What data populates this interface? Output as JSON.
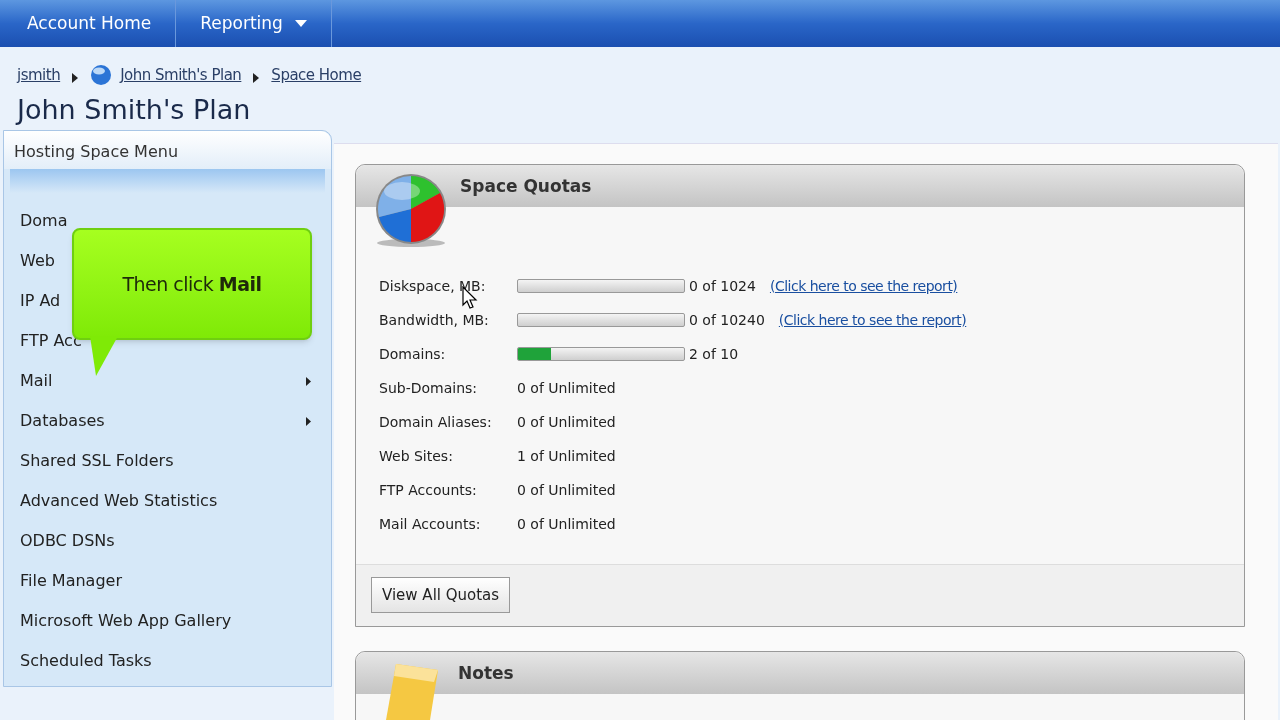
{
  "nav": [
    {
      "label": "Account Home",
      "dropdown": false
    },
    {
      "label": "Reporting",
      "dropdown": true
    }
  ],
  "breadcrumb": [
    {
      "label": "jsmith",
      "icon": false
    },
    {
      "label": "John Smith's Plan",
      "icon": true
    },
    {
      "label": "Space Home",
      "icon": false
    }
  ],
  "page_title": "John Smith's Plan",
  "sidebar": {
    "title": "Hosting Space Menu",
    "items": [
      {
        "label": "Doma",
        "submenu": false
      },
      {
        "label": "Web",
        "submenu": false
      },
      {
        "label": "IP Ad",
        "submenu": false
      },
      {
        "label": "FTP Acc",
        "submenu": false
      },
      {
        "label": "Mail",
        "submenu": true
      },
      {
        "label": "Databases",
        "submenu": true
      },
      {
        "label": "Shared SSL Folders",
        "submenu": false
      },
      {
        "label": "Advanced Web Statistics",
        "submenu": false
      },
      {
        "label": "ODBC DSNs",
        "submenu": false
      },
      {
        "label": "File Manager",
        "submenu": false
      },
      {
        "label": "Microsoft Web App Gallery",
        "submenu": false
      },
      {
        "label": "Scheduled Tasks",
        "submenu": false
      }
    ]
  },
  "callout": "Then click **Mail**",
  "quotas": {
    "title": "Space Quotas",
    "rows": [
      {
        "kind": "bar",
        "label": "Diskspace, MB:",
        "level": 0,
        "value": "0 of 1024",
        "link": "(Click here to see the report)"
      },
      {
        "kind": "bar",
        "label": "Bandwidth, MB:",
        "level": 0,
        "value": "0 of 10240",
        "link": "(Click here to see the report)"
      },
      {
        "kind": "bar",
        "label": "Domains:",
        "level": 0.2,
        "value": "2 of 10"
      },
      {
        "kind": "text",
        "label": "Sub-Domains:",
        "value": "0 of Unlimited"
      },
      {
        "kind": "text",
        "label": "Domain Aliases:",
        "value": "0 of Unlimited"
      },
      {
        "kind": "text",
        "label": "Web Sites:",
        "value": "1 of Unlimited"
      },
      {
        "kind": "text",
        "label": "FTP Accounts:",
        "value": "0 of Unlimited"
      },
      {
        "kind": "text",
        "label": "Mail Accounts:",
        "value": "0 of Unlimited"
      }
    ],
    "button": "View All Quotas"
  },
  "notes": {
    "title": "Notes"
  }
}
